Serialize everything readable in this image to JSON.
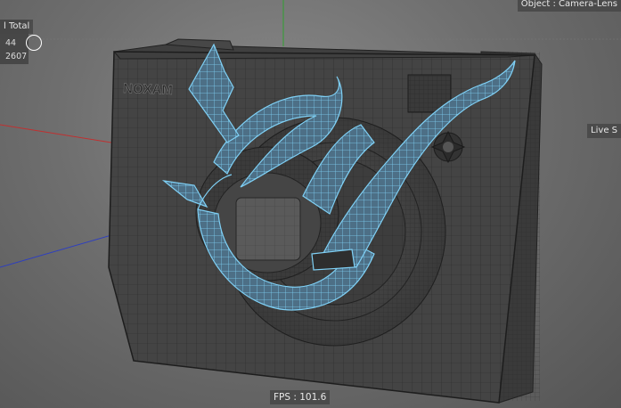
{
  "stats": {
    "title": "l Total",
    "values": [
      "44",
      "2607"
    ]
  },
  "object_label": "Object : Camera-Lens",
  "live_label": "Live S",
  "fps_label": "FPS : 101.6",
  "brand_text": "NOXAM",
  "colors": {
    "background": "#6f6f6f",
    "mesh_dark": "#3b3b3b",
    "wire": "#1f1f1f",
    "selection_wire": "#5ab9e8",
    "axis_x": "#c03030",
    "axis_y": "#2fa02f",
    "axis_z": "#2e3fbf"
  }
}
